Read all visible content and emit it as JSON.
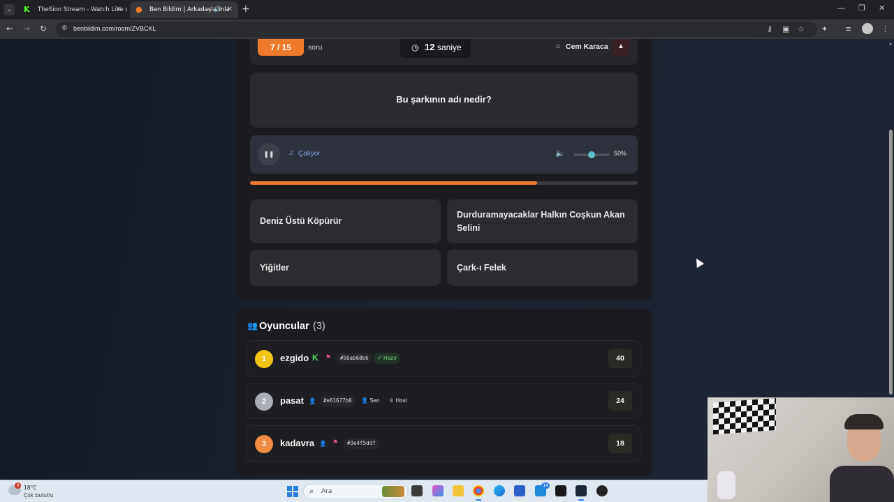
{
  "browser": {
    "tabs": [
      {
        "title": "TheSion Stream - Watch Live on",
        "favicon": "kick-icon"
      },
      {
        "title": "Ben Bildim | Arkadaşlarınla",
        "favicon": "benbildim-icon"
      }
    ],
    "url": "benbildim.com/room/ZVBCKL"
  },
  "game": {
    "question_number": "7 / 15",
    "question_word": "soru",
    "timer_value": "12",
    "timer_unit": "saniye",
    "category": "Cem Karaca",
    "question": "Bu şarkının adı nedir?",
    "player_status": "Çalıyor",
    "volume_label": "50%",
    "volume": 0.5,
    "progress": 0.74,
    "answers": [
      "Deniz Üstü Köpürür",
      "Durduramayacaklar Halkın Coşkun Akan Selini",
      "Yiğitler",
      "Çark-ı Felek"
    ]
  },
  "players": {
    "title": "Oyuncular",
    "count": "(3)",
    "list": [
      {
        "rank": "1",
        "name": "ezgido",
        "id": "#50ab68b6",
        "status": "Hazır",
        "score": "40"
      },
      {
        "rank": "2",
        "name": "pasat",
        "id": "#e61677b0",
        "you": "Sen",
        "host": "Host",
        "score": "24"
      },
      {
        "rank": "3",
        "name": "kadavra",
        "id": "#3e4f5ddf",
        "score": "18"
      }
    ]
  },
  "taskbar": {
    "badge": "9",
    "temperature": "18°C",
    "weather": "Çok bulutlu",
    "search_placeholder": "Ara",
    "app_badge": "14"
  },
  "colors": {
    "accent": "#f07a2b",
    "progress": "#ee7a33",
    "gold": "#f2c215",
    "silver": "#a9adb6",
    "bronze": "#ef8a42"
  }
}
